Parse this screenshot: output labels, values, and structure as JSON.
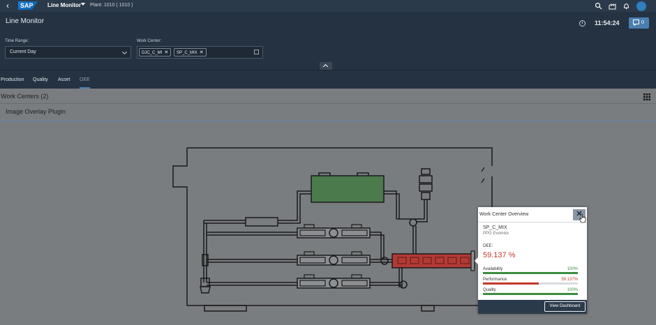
{
  "shellbar": {
    "app_title": "Line Monitor",
    "plant": "Plant: 1010 ( 1010 )"
  },
  "header": {
    "page_title": "Line Monitor",
    "time": "11:54:24",
    "notification_count": "0",
    "time_range": {
      "label": "Time Range:",
      "value": "Current Day"
    },
    "work_center": {
      "label": "Work Center:",
      "tokens": [
        "DJC_C_MI",
        "SP_C_MIX"
      ]
    }
  },
  "tabs": [
    {
      "label": "Production",
      "selected": false
    },
    {
      "label": "Quality",
      "selected": false
    },
    {
      "label": "Asset",
      "selected": false
    },
    {
      "label": "OEE",
      "selected": true
    }
  ],
  "content": {
    "work_centers_title": "Work Centers (2)",
    "plugin_title": "Image Overlay Plugin"
  },
  "colors": {
    "mixer_green": "#4b7a4d",
    "alert_red": "#b23a35",
    "good": "#3c8d40",
    "bad": "#c0392b"
  },
  "popover": {
    "title": "Work Center Overview",
    "work_center": "SP_C_MIX",
    "description": "PPG Evomixx",
    "oee_label": "OEE:",
    "oee_value": "59.137 %",
    "metrics": [
      {
        "name": "Availability",
        "value_text": "100%",
        "percent": 100,
        "status": "good"
      },
      {
        "name": "Performance",
        "value_text": "59.137%",
        "percent": 59.137,
        "status": "bad"
      },
      {
        "name": "Quality",
        "value_text": "100%",
        "percent": 100,
        "status": "good"
      }
    ],
    "view_dashboard": "View Dashboard"
  }
}
